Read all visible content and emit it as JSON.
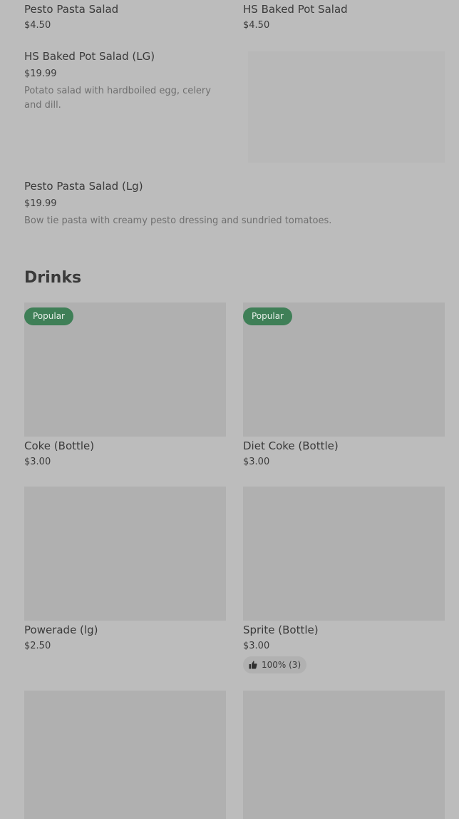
{
  "top_row": [
    {
      "name": "Pesto Pasta Salad",
      "price": "$4.50"
    },
    {
      "name": "HS Baked Pot Salad",
      "price": "$4.50"
    }
  ],
  "featured_items": [
    {
      "name": "HS Baked Pot Salad (LG)",
      "price": "$19.99",
      "description": "Potato salad with hardboiled egg, celery and dill."
    },
    {
      "name": "Pesto Pasta Salad (Lg)",
      "price": "$19.99",
      "description": "Bow tie pasta with creamy pesto dressing and sundried tomatoes."
    }
  ],
  "drinks": {
    "title": "Drinks",
    "badge_label": "Popular",
    "items": [
      {
        "name": "Coke (Bottle)",
        "price": "$3.00"
      },
      {
        "name": "Diet Coke (Bottle)",
        "price": "$3.00"
      },
      {
        "name": "Powerade (lg)",
        "price": "$2.50"
      },
      {
        "name": "Sprite (Bottle)",
        "price": "$3.00",
        "rating": "100% (3)"
      }
    ]
  },
  "icons": {
    "rating": "thumbs-up-icon"
  }
}
